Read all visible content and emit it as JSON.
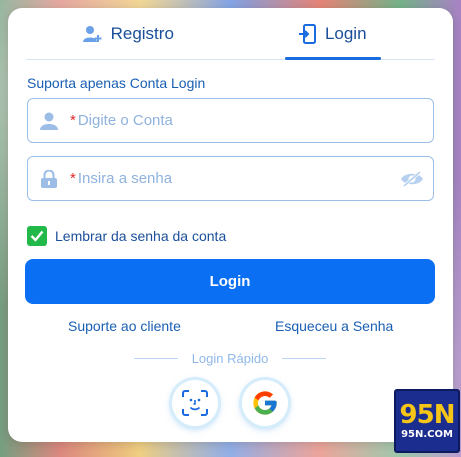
{
  "tabs": [
    {
      "label": "Registro",
      "icon": "add-user-icon",
      "active": false
    },
    {
      "label": "Login",
      "icon": "login-door-icon",
      "active": true
    }
  ],
  "note": "Suporta apenas Conta Login",
  "account_field": {
    "placeholder": "Digite o Conta",
    "value": "",
    "required_mark": "*",
    "icon": "user-icon"
  },
  "password_field": {
    "placeholder": "Insira a senha",
    "value": "",
    "required_mark": "*",
    "icon": "lock-icon",
    "toggle_icon": "eye-hidden-icon"
  },
  "remember": {
    "label": "Lembrar da senha da conta",
    "checked": true
  },
  "login_button": "Login",
  "support_link": "Suporte ao cliente",
  "forgot_link": "Esqueceu a Senha",
  "quick_login": {
    "label": "Login Rápido",
    "options": [
      {
        "name": "face-id-icon"
      },
      {
        "name": "google-icon"
      }
    ]
  },
  "brand": {
    "big": "95N",
    "small": "95N.COM"
  },
  "colors": {
    "accent": "#0a6ff2",
    "link": "#1a5fb4",
    "check": "#22b84a",
    "required": "#e02b2b"
  }
}
